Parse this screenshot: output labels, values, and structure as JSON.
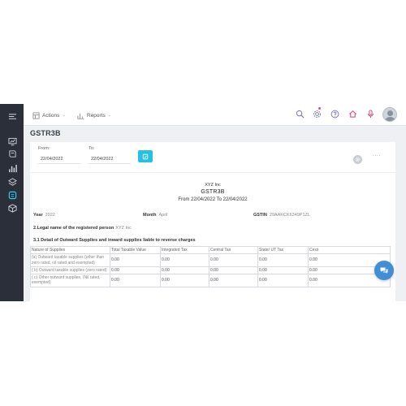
{
  "topbar": {
    "actions_label": "Actions",
    "reports_label": "Reports"
  },
  "page": {
    "title": "GSTR3B"
  },
  "filters": {
    "from_label": "From:",
    "from_value": "22/04/2022",
    "to_label": "To:",
    "to_value": "22/04/2022",
    "more_label": "...."
  },
  "report": {
    "company": "XYZ Inc",
    "title": "GSTR3B",
    "period": "From  22/04/2022  To  22/04/2022",
    "year_label": "Year",
    "year_value": "2022",
    "month_label": "Month",
    "month_value": "April",
    "gstin_label": "GSTIN",
    "gstin_value": "29AAKCK6349P1ZL",
    "legal_label": "2.Legal name of the registered person",
    "legal_value": "XYZ Inc",
    "section_title": "3.1 Detail of Outward Supplies and inward supplies liable to reverse charges"
  },
  "table": {
    "columns": [
      "Nature of Supplies",
      "Total Taxable Value",
      "Integrated Tax",
      "Central Tax",
      "State/ UT Tax",
      "Cess"
    ],
    "rows": [
      {
        "nature": "(a) Outward taxable supplies (other than zero rated, nil rated and exempted)",
        "values": [
          "0.00",
          "0.00",
          "0.00",
          "0.00",
          "0.00"
        ]
      },
      {
        "nature": "( b) Outward taxable supplies (zero rated)",
        "values": [
          "0.00",
          "0.00",
          "0.00",
          "0.00",
          "0.00"
        ]
      },
      {
        "nature": "( c) Other outward supplies, (Nil rated, exempted)",
        "values": [
          "0.00",
          "0.00",
          "0.00",
          "0.00",
          "0.00"
        ]
      }
    ]
  },
  "colors": {
    "sidebar": "#2b2f3a",
    "accent": "#27c0e2",
    "chat": "#3f8ed6",
    "notification": "#e14f8a"
  },
  "icons": {
    "sidebar": [
      "hamburger-icon",
      "chart-board-icon",
      "book-icon",
      "bar-chart-icon",
      "layers-icon",
      "stack-active-icon",
      "box-icon"
    ],
    "topbar": [
      "search-icon",
      "settings-icon",
      "help-icon",
      "home-icon",
      "microphone-icon",
      "user-avatar"
    ]
  }
}
